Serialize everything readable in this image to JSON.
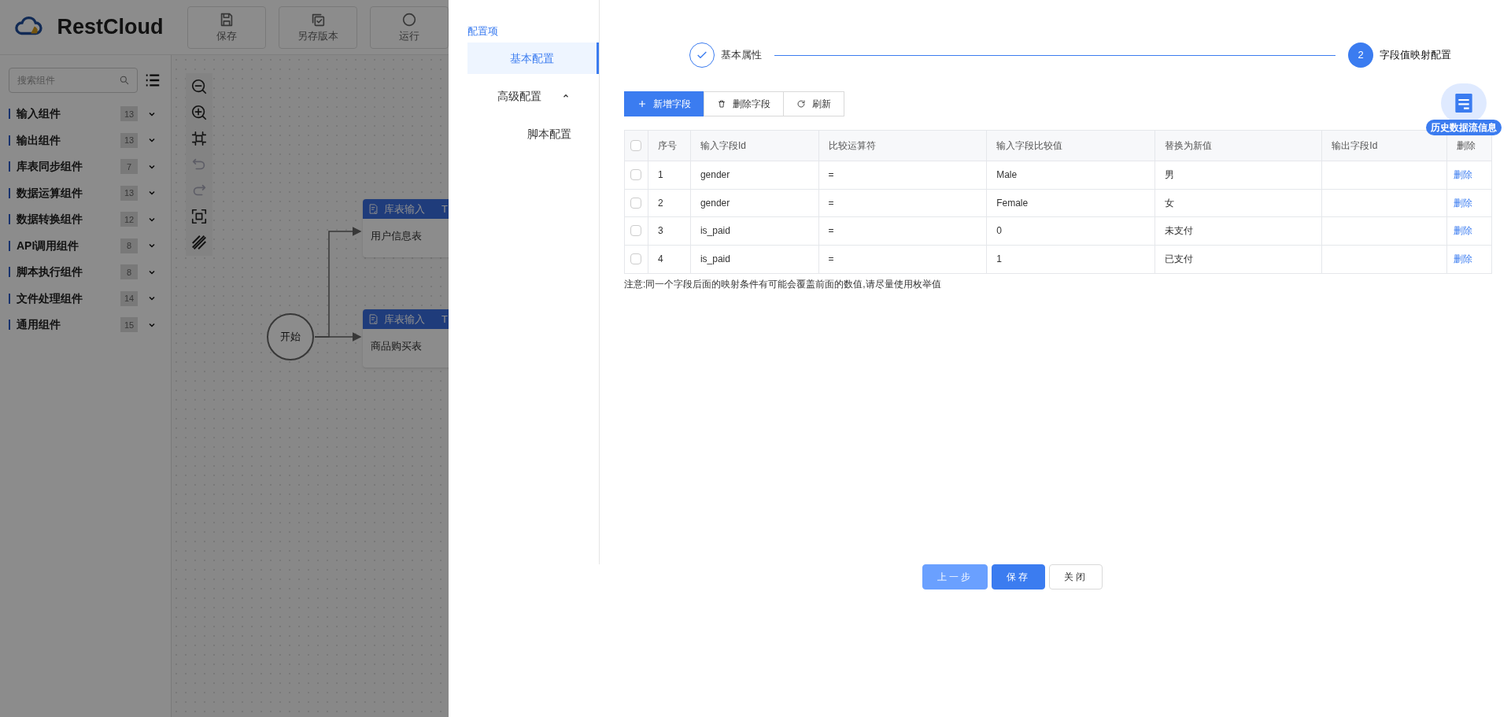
{
  "app": {
    "logo": "RestCloud",
    "toolbar": [
      {
        "label": "保存",
        "kind": "save"
      },
      {
        "label": "另存版本",
        "kind": "copy"
      },
      {
        "label": "运行",
        "kind": "run"
      }
    ]
  },
  "component_search": {
    "placeholder": "搜索组件"
  },
  "component_groups": [
    {
      "label": "输入组件",
      "count": "13"
    },
    {
      "label": "输出组件",
      "count": "13"
    },
    {
      "label": "库表同步组件",
      "count": "7"
    },
    {
      "label": "数据运算组件",
      "count": "13"
    },
    {
      "label": "数据转换组件",
      "count": "12"
    },
    {
      "label": "API调用组件",
      "count": "8"
    },
    {
      "label": "脚本执行组件",
      "count": "8"
    },
    {
      "label": "文件处理组件",
      "count": "14"
    },
    {
      "label": "通用组件",
      "count": "15"
    }
  ],
  "canvas_tools": [
    {
      "kind": "zoom-out",
      "disabled": false
    },
    {
      "kind": "zoom-in",
      "disabled": false
    },
    {
      "kind": "fit",
      "disabled": false
    },
    {
      "kind": "undo",
      "disabled": true
    },
    {
      "kind": "redo",
      "disabled": true
    },
    {
      "kind": "fullscreen",
      "disabled": false
    },
    {
      "kind": "pattern",
      "disabled": false
    }
  ],
  "canvas": {
    "start_node": "开始",
    "nodes": [
      {
        "type": "库表输入",
        "tag": "T",
        "name": "用户信息表"
      },
      {
        "type": "库表输入",
        "tag": "T",
        "name": "商品购买表"
      }
    ]
  },
  "drawer": {
    "menu_title": "配置项",
    "menu": [
      {
        "label": "基本配置",
        "selected": true
      },
      {
        "label": "高级配置",
        "selected": false,
        "expanded": true,
        "children": [
          {
            "label": "脚本配置",
            "selected": false
          }
        ]
      }
    ],
    "steps": [
      {
        "label": "基本属性",
        "completed": true,
        "selected": false
      },
      {
        "label": "字段值映射配置",
        "completed": false,
        "selected": true,
        "marker": "2"
      }
    ],
    "toolbar": [
      {
        "label": "新增字段",
        "kind": "add"
      },
      {
        "label": "删除字段",
        "kind": "delete"
      },
      {
        "label": "刷新",
        "kind": "refresh"
      }
    ],
    "history_badge": "历史数据流信息",
    "table": {
      "all_selected": false,
      "columns": [
        "序号",
        "输入字段Id",
        "比较运算符",
        "输入字段比较值",
        "替换为新值",
        "输出字段Id",
        "删除"
      ],
      "rows": [
        {
          "selected": false,
          "no": "1",
          "input_id": "gender",
          "operator": "=",
          "compare_value": "Male",
          "new_value": "男",
          "action": "删除"
        },
        {
          "selected": false,
          "no": "2",
          "input_id": "gender",
          "operator": "=",
          "compare_value": "Female",
          "new_value": "女",
          "action": "删除"
        },
        {
          "selected": false,
          "no": "3",
          "input_id": "is_paid",
          "operator": "=",
          "compare_value": "0",
          "new_value": "未支付",
          "action": "删除"
        },
        {
          "selected": false,
          "no": "4",
          "input_id": "is_paid",
          "operator": "=",
          "compare_value": "1",
          "new_value": "已支付",
          "action": "删除"
        }
      ]
    },
    "note": "注意:同一个字段后面的映射条件有可能会覆盖前面的数值,请尽量使用枚举值",
    "buttons": [
      {
        "label": "上一步",
        "kind": "secondary"
      },
      {
        "label": "保存",
        "kind": "primary"
      },
      {
        "label": "关闭",
        "kind": "default"
      }
    ]
  }
}
